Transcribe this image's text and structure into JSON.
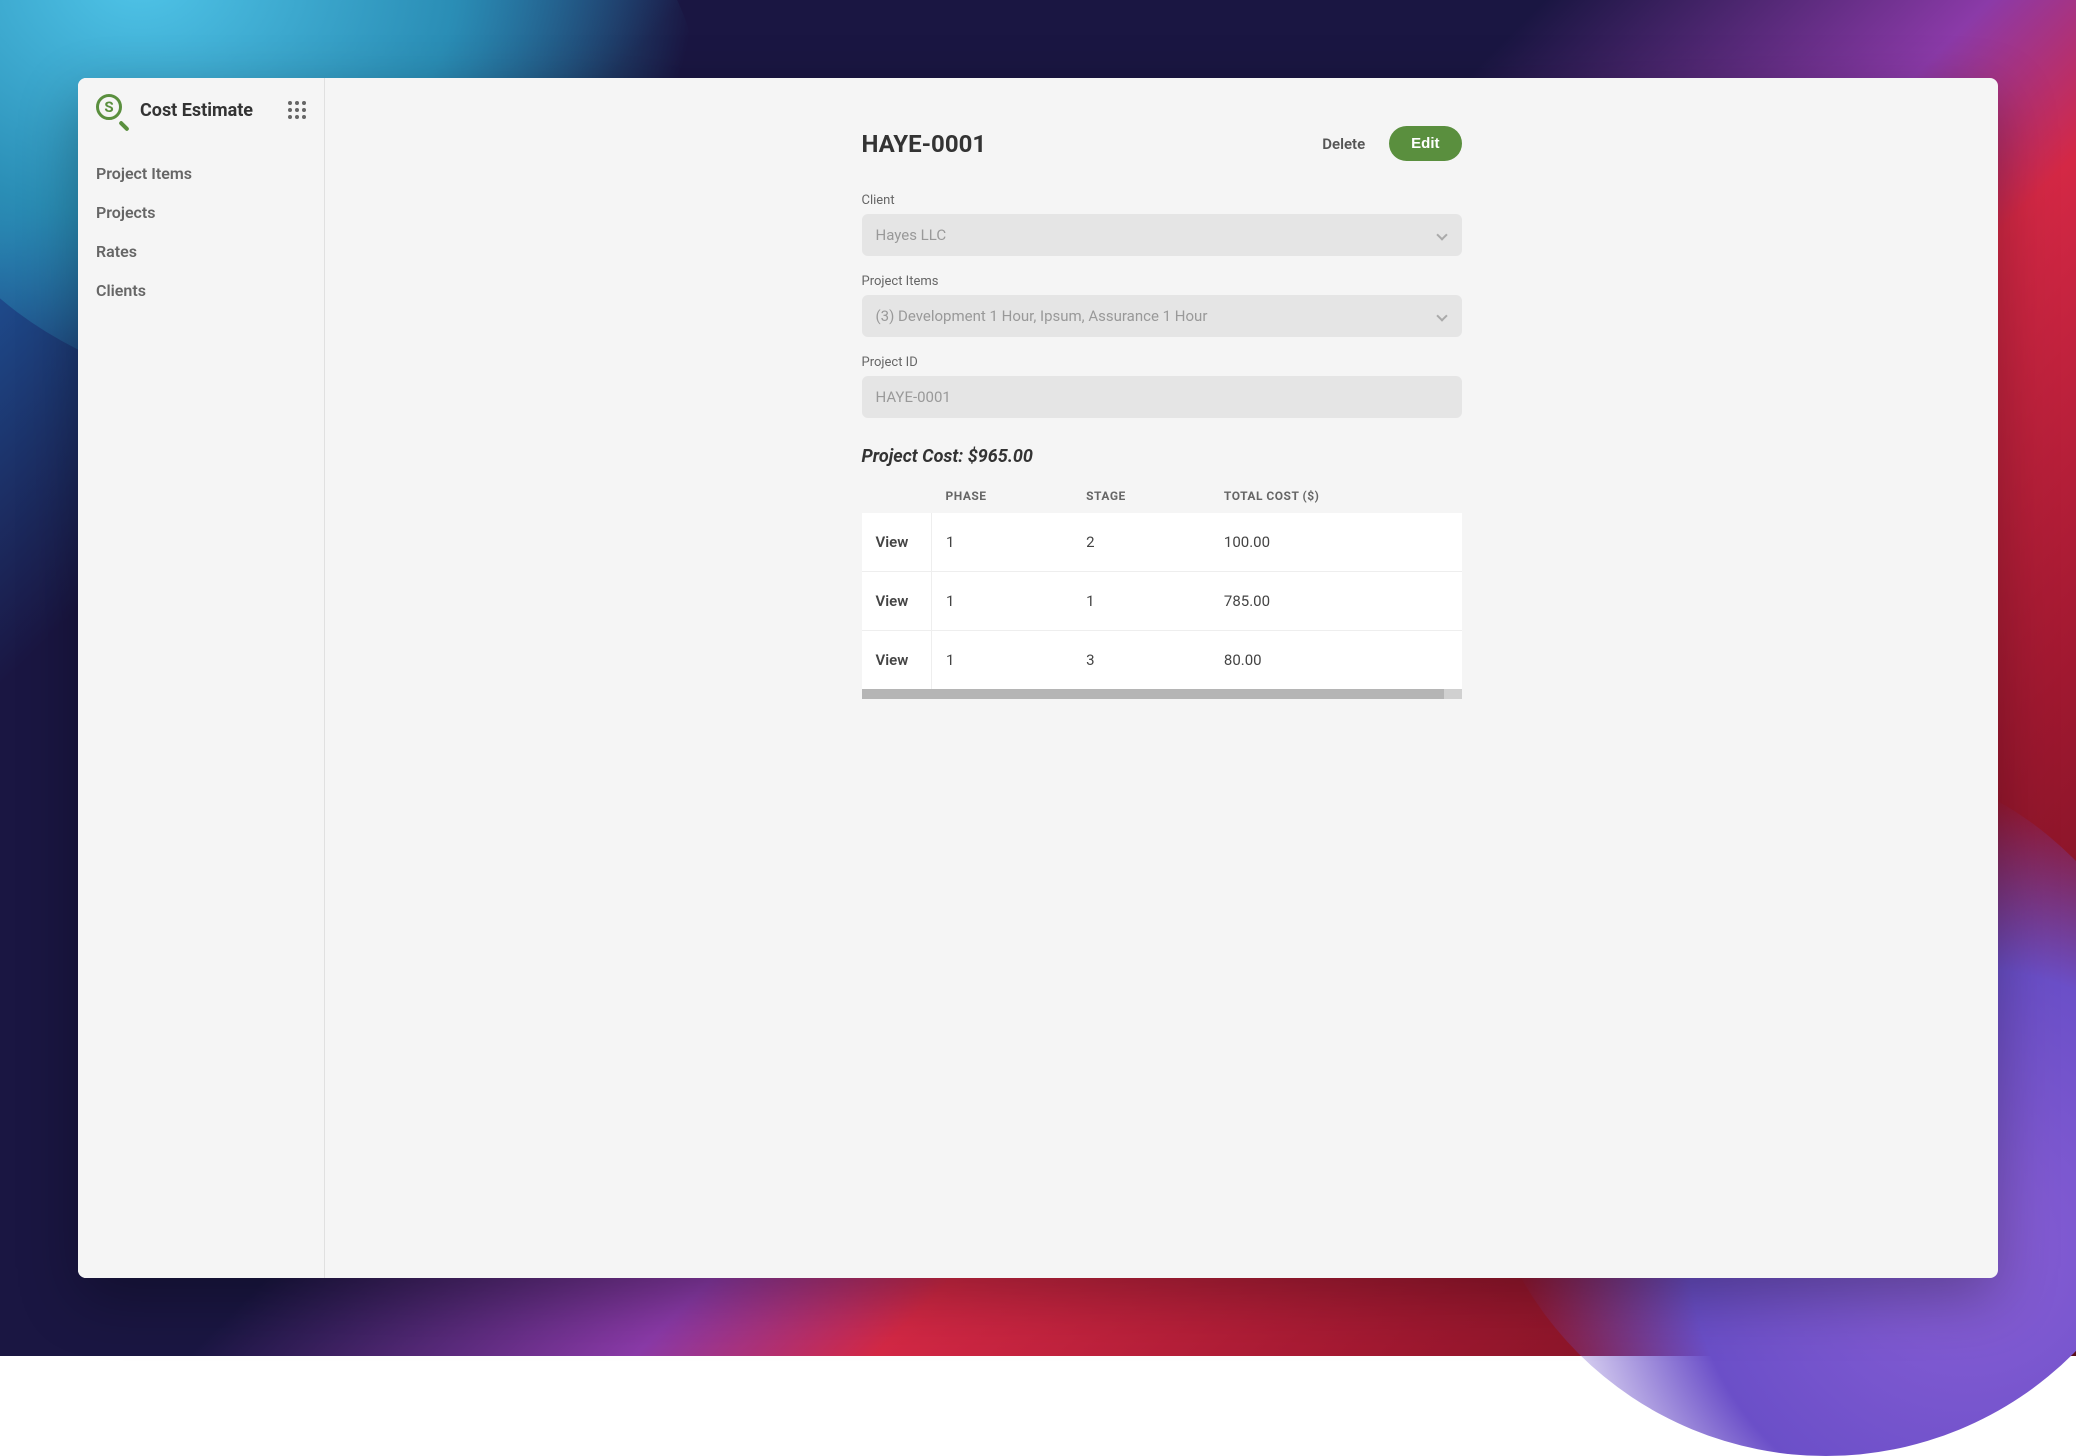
{
  "app": {
    "title": "Cost Estimate"
  },
  "sidebar": {
    "items": [
      {
        "label": "Project Items"
      },
      {
        "label": "Projects"
      },
      {
        "label": "Rates"
      },
      {
        "label": "Clients"
      }
    ]
  },
  "page": {
    "title": "HAYE-0001",
    "delete_label": "Delete",
    "edit_label": "Edit"
  },
  "form": {
    "client": {
      "label": "Client",
      "value": "Hayes LLC"
    },
    "project_items": {
      "label": "Project Items",
      "value": "(3) Development 1 Hour, Ipsum, Assurance 1 Hour"
    },
    "project_id": {
      "label": "Project ID",
      "value": "HAYE-0001"
    }
  },
  "cost_summary": "Project Cost: $965.00",
  "table": {
    "headers": {
      "phase": "PHASE",
      "stage": "STAGE",
      "total_cost": "TOTAL COST ($)"
    },
    "view_label": "View",
    "rows": [
      {
        "phase": "1",
        "stage": "2",
        "total_cost": "100.00"
      },
      {
        "phase": "1",
        "stage": "1",
        "total_cost": "785.00"
      },
      {
        "phase": "1",
        "stage": "3",
        "total_cost": "80.00"
      }
    ]
  }
}
